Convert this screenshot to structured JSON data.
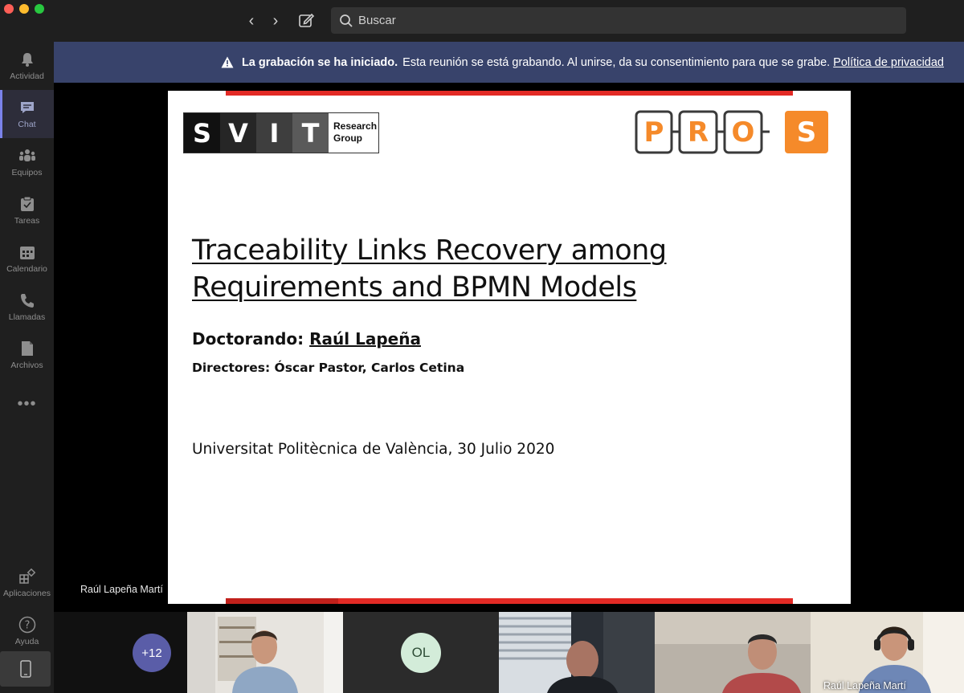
{
  "window": {
    "search_placeholder": "Buscar"
  },
  "sidebar": {
    "items": [
      {
        "label": "Actividad",
        "icon": "bell-icon"
      },
      {
        "label": "Chat",
        "icon": "chat-icon"
      },
      {
        "label": "Equipos",
        "icon": "teams-icon"
      },
      {
        "label": "Tareas",
        "icon": "tasks-icon"
      },
      {
        "label": "Calendario",
        "icon": "calendar-icon"
      },
      {
        "label": "Llamadas",
        "icon": "phone-icon"
      },
      {
        "label": "Archivos",
        "icon": "file-icon"
      }
    ],
    "more": "•••",
    "apps_label": "Aplicaciones",
    "help_label": "Ayuda",
    "active": "Chat"
  },
  "banner": {
    "bold": "La grabación se ha iniciado.",
    "text": "Esta reunión se está grabando. Al unirse, da su consentimiento para que se grabe.",
    "link": "Política de privacidad"
  },
  "slide": {
    "svit_letters": [
      "S",
      "V",
      "I",
      "T"
    ],
    "svit_sub_1": "Research",
    "svit_sub_2": "Group",
    "pros_letters": [
      "P",
      "R",
      "O",
      "S"
    ],
    "title": "Traceability Links Recovery among Requirements and BPMN Models",
    "doctorando_label": "Doctorando:",
    "doctorando_name": "Raúl Lapeña",
    "directores": "Directores: Óscar Pastor, Carlos Cetina",
    "university": "Universitat Politècnica de València, 30 Julio 2020"
  },
  "presenter": "Raúl Lapeña Martí",
  "participants": {
    "more_count": "+12",
    "initials": "OL",
    "self_name": "Raúl Lapeña Martí"
  },
  "colors": {
    "accent": "#7b83eb",
    "banner": "#38436b",
    "slide_red": "#e22a25",
    "pros_orange": "#f58a2a"
  }
}
